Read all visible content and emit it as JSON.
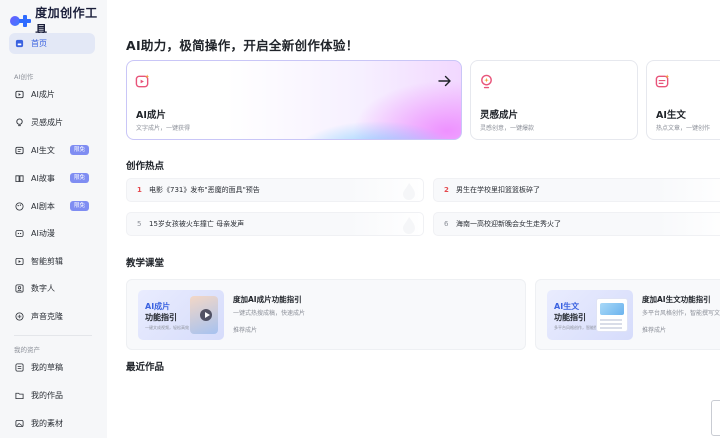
{
  "app": {
    "logo_text": "度加创作工具"
  },
  "sidebar": {
    "home": {
      "label": "首页"
    },
    "ai_section_label": "AI创作",
    "ai_items": [
      {
        "label": "AI成片",
        "icon": "video-spark-icon"
      },
      {
        "label": "灵感成片",
        "icon": "bulb-icon"
      },
      {
        "label": "AI生文",
        "icon": "text-spark-icon",
        "badge": "限免"
      },
      {
        "label": "AI故事",
        "icon": "book-icon",
        "badge": "限免"
      },
      {
        "label": "AI剧本",
        "icon": "palette-icon",
        "badge": "限免"
      },
      {
        "label": "AI动漫",
        "icon": "anime-icon"
      },
      {
        "label": "智能剪辑",
        "icon": "scissor-icon"
      },
      {
        "label": "数字人",
        "icon": "avatar-icon"
      },
      {
        "label": "声音克隆",
        "icon": "voice-icon"
      }
    ],
    "assets_section_label": "我的资产",
    "asset_items": [
      {
        "label": "我的草稿",
        "icon": "draft-icon"
      },
      {
        "label": "我的作品",
        "icon": "folder-icon"
      },
      {
        "label": "我的素材",
        "icon": "image-icon"
      }
    ]
  },
  "main": {
    "headline": "AI助力，极简操作，开启全新创作体验！",
    "feature_cards": [
      {
        "title": "AI成片",
        "subtitle": "文字成片，一键获得"
      },
      {
        "title": "灵感成片",
        "subtitle": "灵感创意，一键爆款"
      },
      {
        "title": "AI生文",
        "subtitle": "热点文章，一键创作"
      }
    ],
    "hot_section_title": "创作热点",
    "hot_items": [
      {
        "rank": "1",
        "text": "电影《731》发布\"恶魔的面具\"预告"
      },
      {
        "rank": "2",
        "text": "男生在学校里扣篮篮板碎了"
      },
      {
        "rank": "5",
        "text": "15岁女孩被火车撞亡 母亲发声"
      },
      {
        "rank": "6",
        "text": "海南一高校迎新晚会女生走秀火了"
      }
    ],
    "course_section_title": "教学课堂",
    "courses": [
      {
        "thumb_line1": "AI成片",
        "thumb_line2": "功能指引",
        "thumb_line3": "一键文成视频，轻松高效",
        "title": "度加AI成片功能指引",
        "subtitle": "一键式热搜成稿，快速成片",
        "tag": "推荐成片"
      },
      {
        "thumb_line1": "AI生文",
        "thumb_line2": "功能指引",
        "thumb_line3": "多平台风格创作，智能撰写文章",
        "title": "度加AI生文功能指引",
        "subtitle": "多平台风格创作，智能撰写文章",
        "tag": "推荐成片"
      }
    ],
    "recent_section_title": "最近作品"
  },
  "colors": {
    "accent": "#3a62e0",
    "badge": "#7f8df2",
    "hot_rank_top": "#e5484d",
    "sidebar_bg": "#f6f7f9"
  }
}
